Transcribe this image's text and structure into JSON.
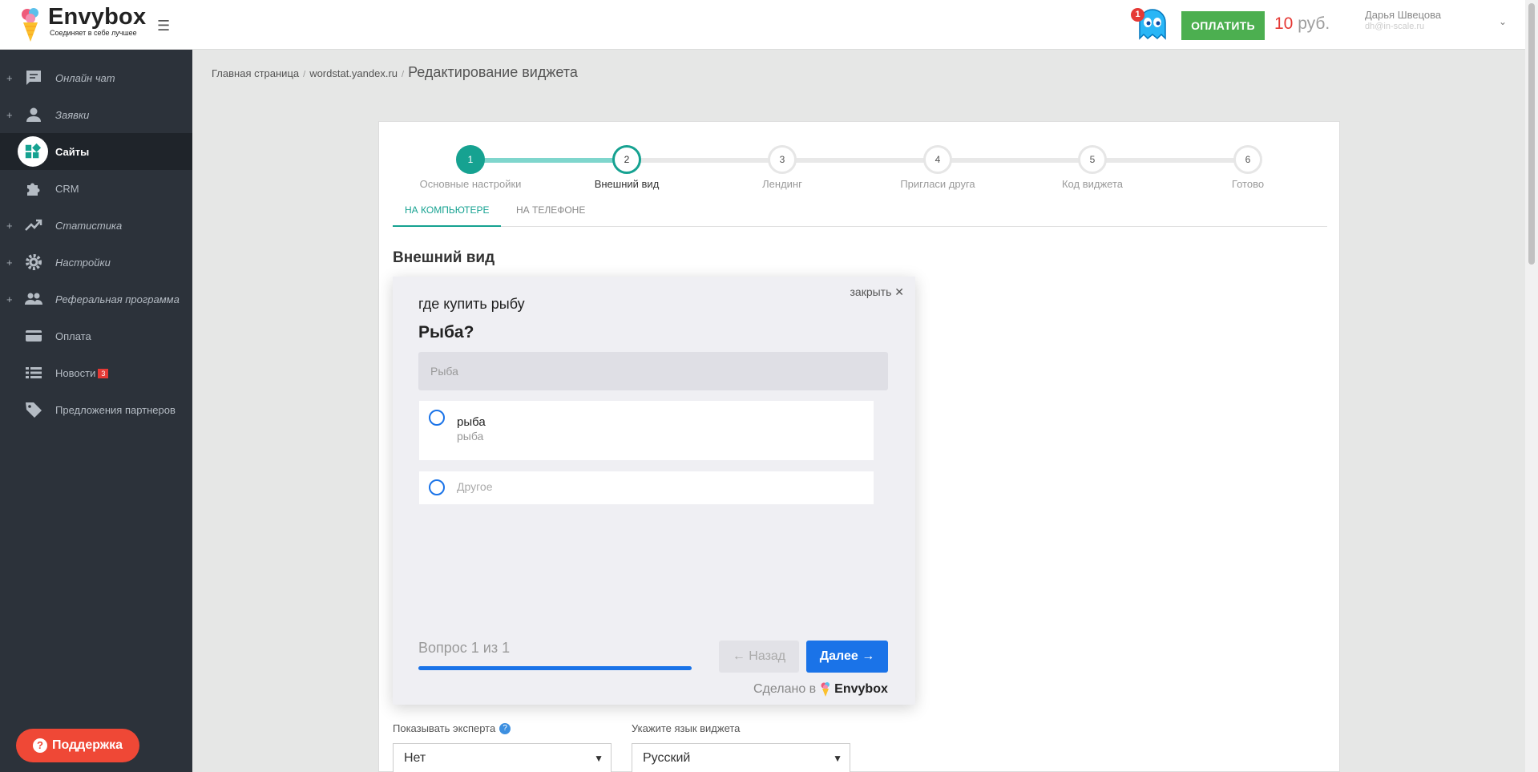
{
  "header": {
    "logo_name": "Envybox",
    "logo_tagline": "Соединяет в себе лучшее",
    "notification_count": "1",
    "pay_button": "ОПЛАТИТЬ",
    "balance_amount": "10",
    "balance_currency": " руб.",
    "user_name": "Дарья Швецова",
    "user_email": "dh@in-scale.ru"
  },
  "sidebar": {
    "items": [
      {
        "label": "Онлайн чат",
        "icon": "chat-icon",
        "expandable": true
      },
      {
        "label": "Заявки",
        "icon": "person-icon",
        "expandable": true
      },
      {
        "label": "Сайты",
        "icon": "widgets-icon",
        "active": true
      },
      {
        "label": "CRM",
        "icon": "puzzle-icon"
      },
      {
        "label": "Статистика",
        "icon": "trending-icon",
        "expandable": true
      },
      {
        "label": "Настройки",
        "icon": "gear-icon",
        "expandable": true
      },
      {
        "label": "Реферальная программа",
        "icon": "people-icon",
        "expandable": true
      },
      {
        "label": "Оплата",
        "icon": "credit-card-icon"
      },
      {
        "label": "Новости",
        "icon": "list-icon",
        "badge": "3"
      },
      {
        "label": "Предложения партнеров",
        "icon": "tag-icon"
      }
    ],
    "support_button": "Поддержка"
  },
  "breadcrumb": {
    "home": "Главная страница",
    "site": "wordstat.yandex.ru",
    "current": "Редактирование виджета"
  },
  "stepper": {
    "steps": [
      {
        "num": "1",
        "label": "Основные настройки",
        "state": "done"
      },
      {
        "num": "2",
        "label": "Внешний вид",
        "state": "current"
      },
      {
        "num": "3",
        "label": "Лендинг",
        "state": "todo"
      },
      {
        "num": "4",
        "label": "Пригласи друга",
        "state": "todo"
      },
      {
        "num": "5",
        "label": "Код виджета",
        "state": "todo"
      },
      {
        "num": "6",
        "label": "Готово",
        "state": "todo"
      }
    ]
  },
  "tabs": {
    "desktop": "НА КОМПЬЮТЕРЕ",
    "mobile": "НА ТЕЛЕФОНЕ"
  },
  "section_title": "Внешний вид",
  "widget": {
    "close_label": "закрыть",
    "question": "где купить рыбу",
    "title": "Рыба?",
    "input_placeholder": "Рыба",
    "option_title": "рыба",
    "option_subtitle": "рыба",
    "other_label": "Другое",
    "progress_text": "Вопрос 1 из 1",
    "progress_fraction": 1.0,
    "back_label": "Назад",
    "next_label": "Далее",
    "made_in": "Сделано в",
    "made_brand": "Envybox",
    "accent_color": "#1a73e8"
  },
  "fields": {
    "expert_label": "Показывать эксперта",
    "expert_value": "Нет",
    "language_label": "Укажите язык виджета",
    "language_value": "Русский"
  },
  "colors": {
    "brand_teal": "#16a291",
    "pay_green": "#4caf50",
    "sidebar_bg": "#2c323a",
    "support_red": "#ef4836"
  }
}
